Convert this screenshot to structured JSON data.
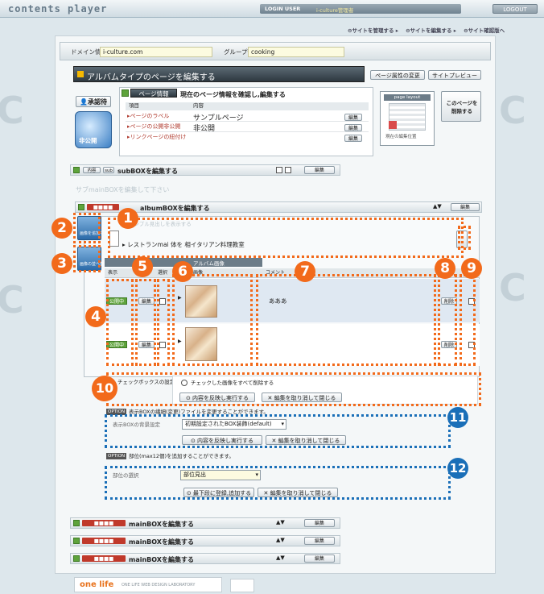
{
  "header": {
    "logo": "contents player",
    "login_label": "LOGIN USER",
    "login_user": "i-culture管理者",
    "logout": "LOGOUT",
    "crumbs": [
      "サイトを管理する",
      "サイトを編集する",
      "サイト確認版へ"
    ]
  },
  "domain": {
    "label": "ドメイン情報",
    "value": "i-culture.com",
    "group_label": "グループ情報",
    "group_value": "cooking"
  },
  "page_title": "アルバムタイプのページを編集する",
  "page_buttons": {
    "change": "ページ属性の変更",
    "preview": "サイトプレビュー"
  },
  "status": {
    "approval": "承認待",
    "publish_state": "非公開"
  },
  "page_info": {
    "tab": "ページ情報",
    "heading": "現在のページ情報を確認し,編集する",
    "col_item": "項目",
    "col_content": "内容",
    "rows": [
      {
        "label": "ページのラベル",
        "value": "サンプルページ",
        "edit": "編集"
      },
      {
        "label": "ページの公開非公開",
        "value": "非公開",
        "edit": "編集"
      },
      {
        "label": "リンクページの紐付け",
        "value": "",
        "edit": "編集"
      }
    ],
    "layout_label": "page layout",
    "layout_caption": "現在の編集位置",
    "delete_label": "このページを削除する"
  },
  "subbox": {
    "label": "subBOXを編集する",
    "edit": "編集",
    "tag": "内容",
    "tag2": "sub"
  },
  "faint_caption": "サブmainBOXを編集して下さい",
  "album": {
    "label": "albumBOXを編集する",
    "edit": "編集",
    "heading_text": "サンプル見出しを表示する",
    "heading_value": "レストランmai 体を 相イタリアン料理教室",
    "side_buttons": [
      "画像を追加する",
      "画像の並べ替え"
    ],
    "title_tab": "アルバム画像",
    "columns": [
      "表示",
      "編集",
      "選択",
      "画像",
      "コメント",
      "編集",
      "削除"
    ],
    "rows": [
      {
        "status": "公開中",
        "edit": "編集",
        "comment": "あああ",
        "edit2": "削除"
      },
      {
        "status": "公開中",
        "edit": "編集",
        "comment": "",
        "edit2": "削除"
      }
    ],
    "checkbox_label": "チェックボックスの設定",
    "radio_label": "チェックした画像をすべて削除する",
    "exec": "内容を反映し実行する",
    "cancel": "編集を取り消して閉じる"
  },
  "option1": {
    "tag": "OPTION",
    "text": "表示BOXの繊細(変更)ファイルを変更することができます。",
    "label": "表示BOXの背景設定",
    "select": "初期設定されたBOX装飾(default)",
    "apply": "内容を反映し実行する",
    "cancel": "編集を取り消して閉じる"
  },
  "option2": {
    "tag": "OPTION",
    "text": "部位(max12個)を追加することができます。",
    "label": "部位の選択",
    "select": "部位見出",
    "add": "最下段に登録,追加する",
    "cancel": "編集を取り消して閉じる"
  },
  "mainboxes": [
    {
      "label": "mainBOXを編集する",
      "edit": "編集"
    },
    {
      "label": "mainBOXを編集する",
      "edit": "編集"
    },
    {
      "label": "mainBOXを編集する",
      "edit": "編集"
    }
  ],
  "footer": {
    "brand": "one life",
    "tagline": "ONE LIFE WEB DESIGN LABORATORY"
  },
  "callouts": {
    "orange": [
      "1",
      "2",
      "3",
      "4",
      "5",
      "6",
      "7",
      "8",
      "9",
      "10"
    ],
    "blue": [
      "11",
      "12"
    ]
  },
  "colors": {
    "callout_orange": "#f26a1b",
    "callout_blue": "#1a6fb8",
    "bar_dark": "#2d3840",
    "tag_red": "#c0392b"
  }
}
